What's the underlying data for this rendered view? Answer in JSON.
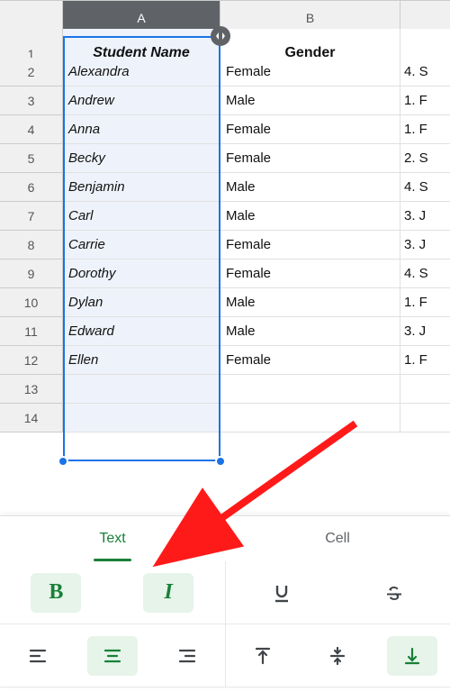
{
  "colors": {
    "accent": "#1a73e8",
    "green": "#188038",
    "annotation": "#ff1a1a"
  },
  "columns": [
    "A",
    "B"
  ],
  "headers": {
    "a": "Student Name",
    "b": "Gender",
    "a_italic": true
  },
  "rows": [
    {
      "n": "2",
      "a": "Alexandra",
      "b": "Female",
      "c": "4. S"
    },
    {
      "n": "3",
      "a": "Andrew",
      "b": "Male",
      "c": "1. F"
    },
    {
      "n": "4",
      "a": "Anna",
      "b": "Female",
      "c": "1. F"
    },
    {
      "n": "5",
      "a": "Becky",
      "b": "Female",
      "c": "2. S"
    },
    {
      "n": "6",
      "a": "Benjamin",
      "b": "Male",
      "c": "4. S"
    },
    {
      "n": "7",
      "a": "Carl",
      "b": "Male",
      "c": "3. J"
    },
    {
      "n": "8",
      "a": "Carrie",
      "b": "Female",
      "c": "3. J"
    },
    {
      "n": "9",
      "a": "Dorothy",
      "b": "Female",
      "c": "4. S"
    },
    {
      "n": "10",
      "a": "Dylan",
      "b": "Male",
      "c": "1. F"
    },
    {
      "n": "11",
      "a": "Edward",
      "b": "Male",
      "c": "3. J"
    },
    {
      "n": "12",
      "a": "Ellen",
      "b": "Female",
      "c": "1. F"
    }
  ],
  "emptyRows": [
    "13",
    "14"
  ],
  "panel": {
    "tabs": {
      "text": "Text",
      "cell": "Cell",
      "active": "text"
    },
    "format": {
      "bold": "B",
      "italic": "I",
      "bold_on": true,
      "italic_on": true,
      "align_active": "center",
      "valign_active": "bottom"
    }
  }
}
